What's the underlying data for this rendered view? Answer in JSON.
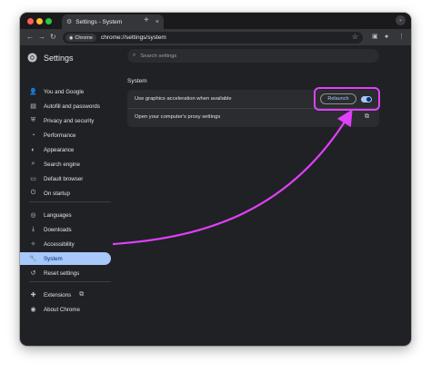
{
  "browser": {
    "tab_title": "Settings - System",
    "tab_close": "×",
    "new_tab": "+",
    "tab_menu": "⌄",
    "chip": "Chrome",
    "url": "chrome://settings/system",
    "colors": {
      "highlight": "#e040fb",
      "accent": "#a8c7fa"
    }
  },
  "sidebar": {
    "title": "Settings",
    "items": [
      {
        "label": "You and Google",
        "icon": "person-icon"
      },
      {
        "label": "Autofill and passwords",
        "icon": "autofill-icon"
      },
      {
        "label": "Privacy and security",
        "icon": "shield-icon"
      },
      {
        "label": "Performance",
        "icon": "speedometer-icon"
      },
      {
        "label": "Appearance",
        "icon": "palette-icon"
      },
      {
        "label": "Search engine",
        "icon": "search-icon"
      },
      {
        "label": "Default browser",
        "icon": "browser-icon"
      },
      {
        "label": "On startup",
        "icon": "power-icon"
      },
      {
        "label": "Languages",
        "icon": "globe-icon"
      },
      {
        "label": "Downloads",
        "icon": "download-icon"
      },
      {
        "label": "Accessibility",
        "icon": "accessibility-icon"
      },
      {
        "label": "System",
        "icon": "wrench-icon",
        "active": true
      },
      {
        "label": "Reset settings",
        "icon": "reset-icon"
      },
      {
        "label": "Extensions",
        "icon": "puzzle-icon"
      },
      {
        "label": "About Chrome",
        "icon": "chrome-icon"
      }
    ]
  },
  "main": {
    "search_placeholder": "Search settings",
    "section_title": "System",
    "rows": [
      {
        "label": "Use graphics acceleration when available",
        "button": "Relaunch",
        "toggle_on": true
      },
      {
        "label": "Open your computer's proxy settings"
      }
    ]
  }
}
